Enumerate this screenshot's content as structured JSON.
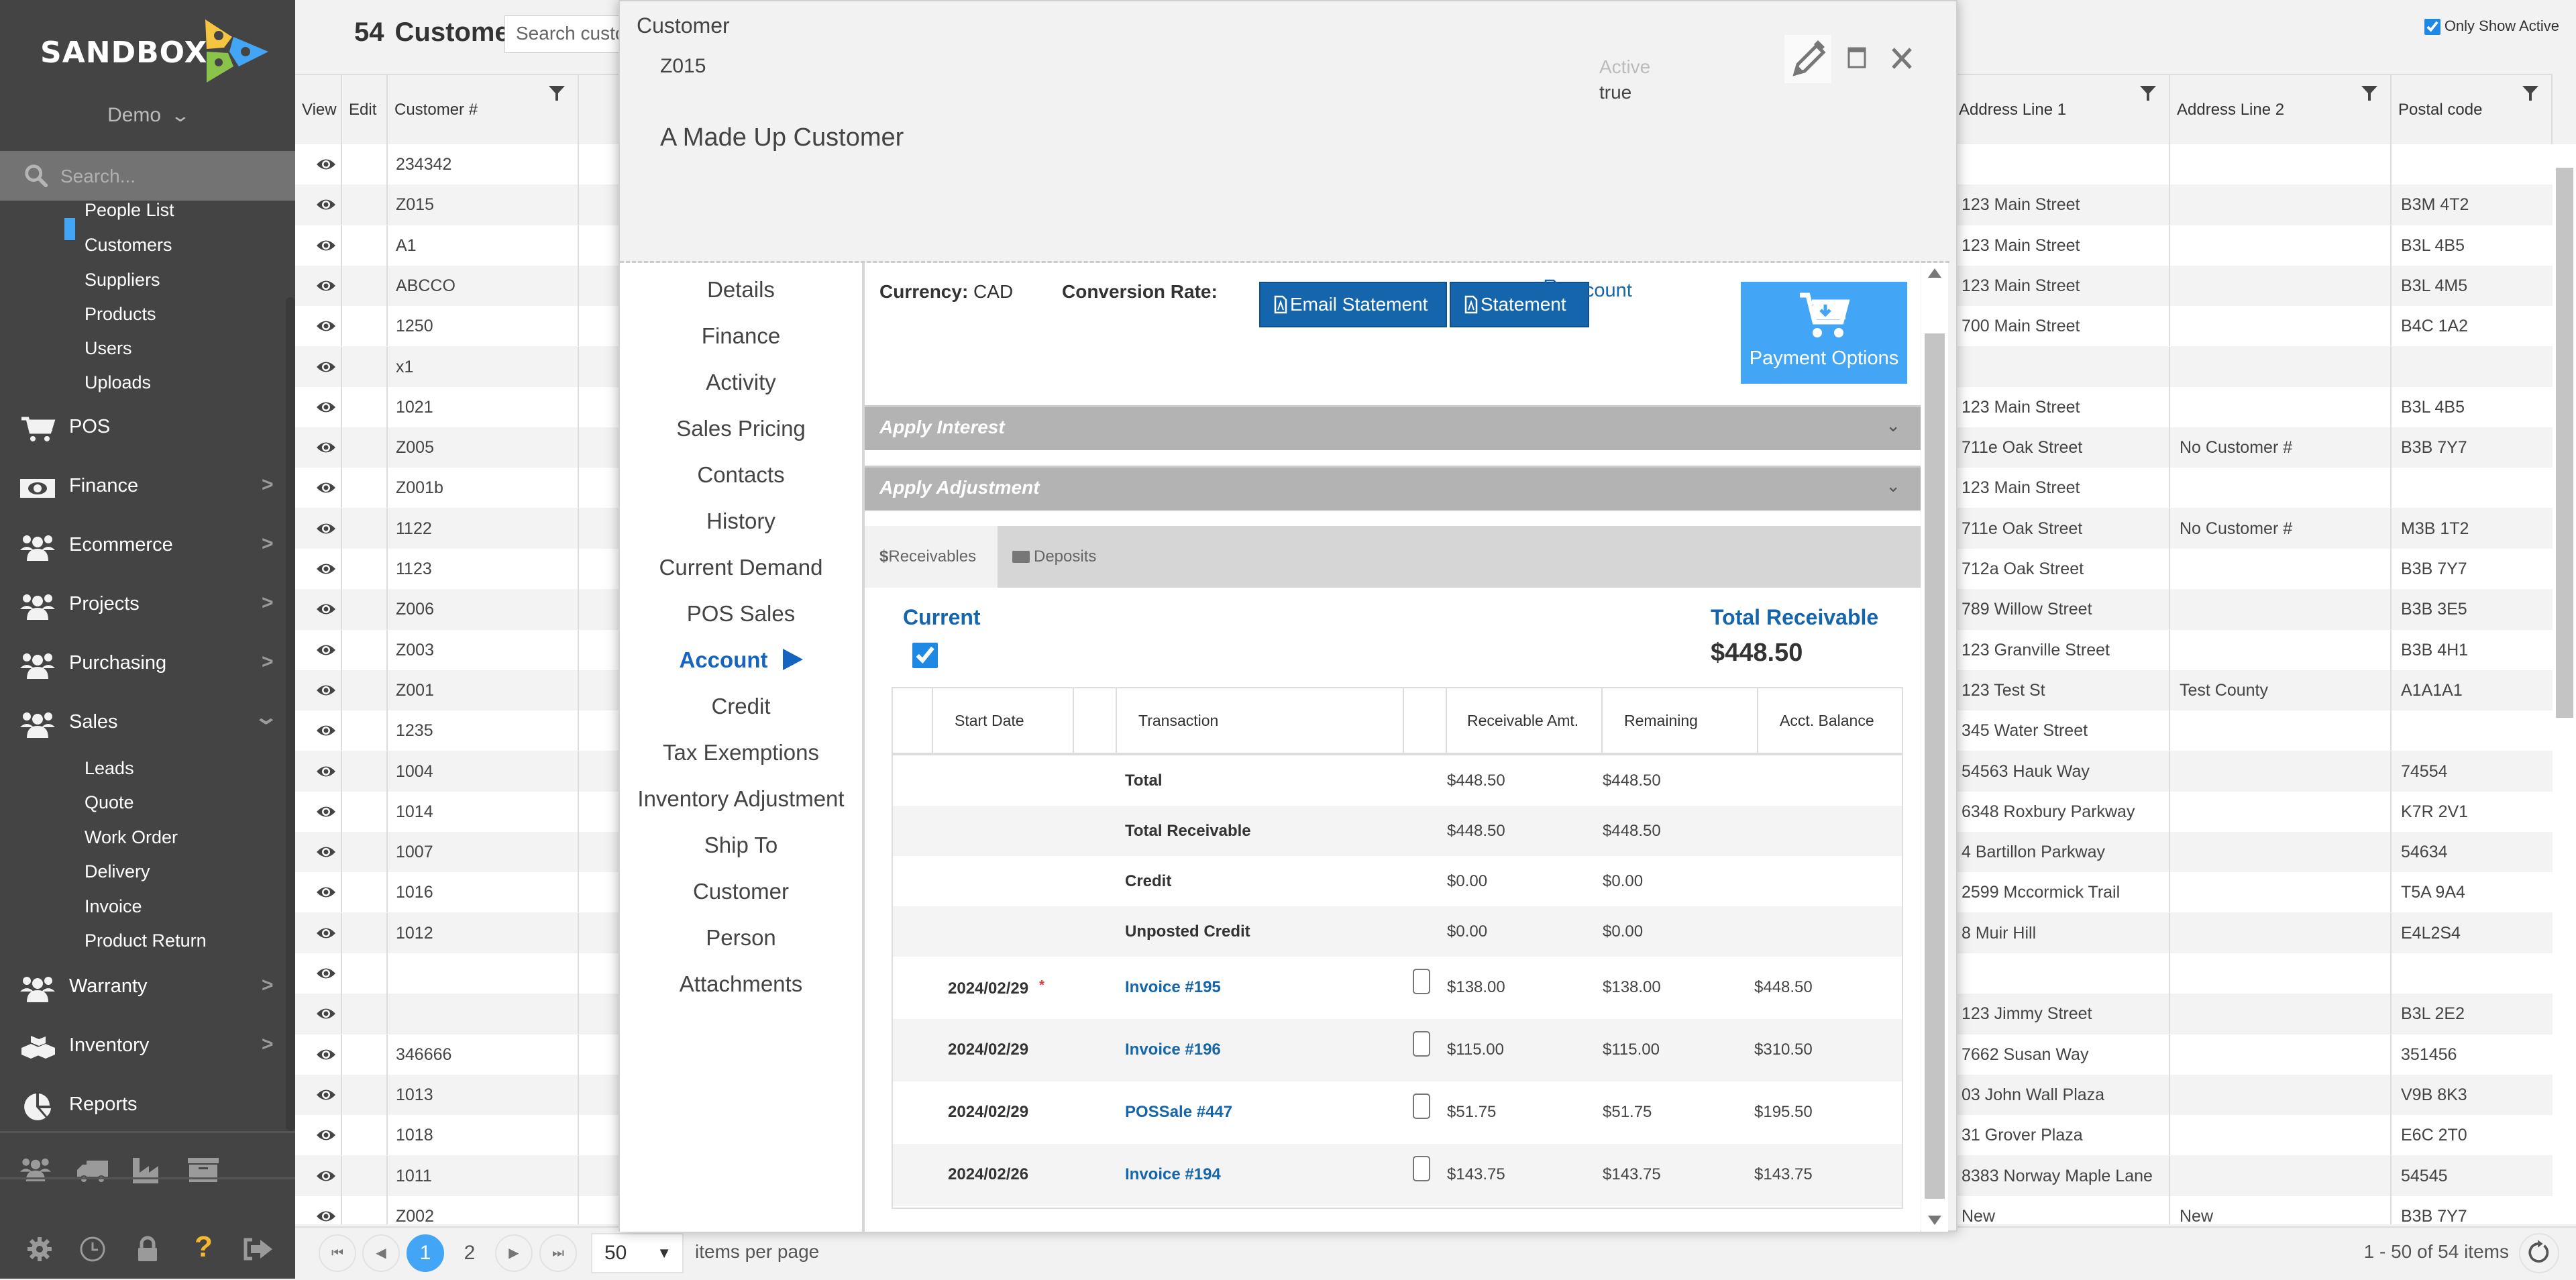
{
  "sidebar": {
    "brand": "SANDBOX",
    "company": "Demo",
    "search_placeholder": "Search...",
    "people_subitems": [
      "People List",
      "Customers",
      "Suppliers",
      "Products",
      "Users",
      "Uploads"
    ],
    "active_subitem": "Customers",
    "main_items": [
      {
        "label": "POS",
        "icon": "cart-icon",
        "arrow": ""
      },
      {
        "label": "Finance",
        "icon": "money-icon",
        "arrow": "right"
      },
      {
        "label": "Ecommerce",
        "icon": "users-icon",
        "arrow": "right"
      },
      {
        "label": "Projects",
        "icon": "users-icon",
        "arrow": "right"
      },
      {
        "label": "Purchasing",
        "icon": "users-icon",
        "arrow": "right"
      },
      {
        "label": "Sales",
        "icon": "users-icon",
        "arrow": "down"
      }
    ],
    "sales_subitems": [
      "Leads",
      "Quote",
      "Work Order",
      "Delivery",
      "Invoice",
      "Product Return"
    ],
    "lower_items": [
      {
        "label": "Warranty",
        "icon": "users-icon",
        "arrow": "right"
      },
      {
        "label": "Inventory",
        "icon": "boxes-icon",
        "arrow": "right"
      },
      {
        "label": "Reports",
        "icon": "pie-chart-icon",
        "arrow": ""
      }
    ],
    "quick_icons": [
      "users-icon",
      "truck-icon",
      "factory-icon",
      "archive-icon"
    ],
    "footer_icons": [
      "gear-icon",
      "clock-icon",
      "lock-icon",
      "help-icon",
      "sign-out-icon"
    ],
    "colors": {
      "bg": "#444444",
      "active_bar": "#42a5f5",
      "help": "#f5b82e"
    }
  },
  "list": {
    "count": "54",
    "title": "Customers",
    "search_placeholder": "Search custo",
    "only_show_active_label": "Only Show Active",
    "only_show_active": true,
    "columns": {
      "view": "View",
      "edit": "Edit",
      "customer_no": "Customer #",
      "address1": "Address Line 1",
      "address2": "Address Line 2",
      "postal": "Postal code"
    },
    "rows": [
      {
        "no": "234342",
        "addr1": "",
        "addr2": "",
        "postal": ""
      },
      {
        "no": "Z015",
        "addr1": "123 Main Street",
        "addr2": "",
        "postal": "B3M 4T2"
      },
      {
        "no": "A1",
        "addr1": "123 Main Street",
        "addr2": "",
        "postal": "B3L 4B5"
      },
      {
        "no": "ABCCO",
        "addr1": "123 Main Street",
        "addr2": "",
        "postal": "B3L 4M5"
      },
      {
        "no": "1250",
        "addr1": "700 Main Street",
        "addr2": "",
        "postal": "B4C 1A2"
      },
      {
        "no": "x1",
        "addr1": "",
        "addr2": "",
        "postal": ""
      },
      {
        "no": "1021",
        "addr1": "123 Main Street",
        "addr2": "",
        "postal": "B3L 4B5"
      },
      {
        "no": "Z005",
        "addr1": "711e Oak Street",
        "addr2": "No Customer #",
        "postal": "B3B 7Y7"
      },
      {
        "no": "Z001b",
        "addr1": "123 Main Street",
        "addr2": "",
        "postal": ""
      },
      {
        "no": "1122",
        "addr1": "711e Oak Street",
        "addr2": "No Customer #",
        "postal": "M3B 1T2"
      },
      {
        "no": "1123",
        "addr1": "712a Oak Street",
        "addr2": "",
        "postal": "B3B 7Y7"
      },
      {
        "no": "Z006",
        "addr1": "789 Willow Street",
        "addr2": "",
        "postal": "B3B 3E5"
      },
      {
        "no": "Z003",
        "addr1": "123 Granville Street",
        "addr2": "",
        "postal": "B3B 4H1"
      },
      {
        "no": "Z001",
        "addr1": "123 Test St",
        "addr2": "Test County",
        "postal": "A1A1A1"
      },
      {
        "no": "1235",
        "addr1": "345 Water Street",
        "addr2": "",
        "postal": ""
      },
      {
        "no": "1004",
        "addr1": "54563 Hauk Way",
        "addr2": "",
        "postal": "74554"
      },
      {
        "no": "1014",
        "addr1": "6348 Roxbury Parkway",
        "addr2": "",
        "postal": "K7R 2V1"
      },
      {
        "no": "1007",
        "addr1": "4 Bartillon Parkway",
        "addr2": "",
        "postal": "54634"
      },
      {
        "no": "1016",
        "addr1": "2599 Mccormick Trail",
        "addr2": "",
        "postal": "T5A 9A4"
      },
      {
        "no": "1012",
        "addr1": "8 Muir Hill",
        "addr2": "",
        "postal": "E4L2S4"
      },
      {
        "no": "",
        "addr1": "",
        "addr2": "",
        "postal": ""
      },
      {
        "no": "",
        "addr1": "123 Jimmy Street",
        "addr2": "",
        "postal": "B3L 2E2"
      },
      {
        "no": "346666",
        "addr1": "7662 Susan Way",
        "addr2": "",
        "postal": "351456"
      },
      {
        "no": "1013",
        "addr1": "03 John Wall Plaza",
        "addr2": "",
        "postal": "V9B 8K3"
      },
      {
        "no": "1018",
        "addr1": "31 Grover Plaza",
        "addr2": "",
        "postal": "E6C 2T0"
      },
      {
        "no": "1011",
        "addr1": "8383 Norway Maple Lane",
        "addr2": "",
        "postal": "54545"
      },
      {
        "no": "Z002",
        "addr1": "New",
        "addr2": "New",
        "postal": "B3B 7Y7"
      }
    ],
    "pager": {
      "pages": [
        "1",
        "2"
      ],
      "current_page": "1",
      "page_size": "50",
      "items_per_page_label": "items per page",
      "info": "1 - 50 of 54 items"
    }
  },
  "modal": {
    "title": "Customer",
    "code": "Z015",
    "name": "A Made Up Customer",
    "active_label": "Active",
    "active_value": "true",
    "nav": [
      "Details",
      "Finance",
      "Activity",
      "Sales Pricing",
      "Contacts",
      "History",
      "Current Demand",
      "POS Sales",
      "Account",
      "Credit",
      "Tax Exemptions",
      "Inventory Adjustment",
      "Ship To",
      "Customer",
      "Person",
      "Attachments"
    ],
    "active_nav": "Account",
    "currency_label": "Currency:",
    "currency_value": "CAD",
    "conversion_label": "Conversion Rate:",
    "conversion_value": "",
    "buttons": {
      "email_statement": "Email Statement",
      "statement": "Statement",
      "account": "Account",
      "payment_options": "Payment Options"
    },
    "accordions": [
      "Apply Interest",
      "Apply Adjustment"
    ],
    "tabs": [
      {
        "label": "Receivables",
        "icon": "dollar-icon",
        "active": true
      },
      {
        "label": "Deposits",
        "icon": "money-icon",
        "active": false
      }
    ],
    "current_label": "Current",
    "current_checked": true,
    "total_receivable_label": "Total Receivable",
    "total_receivable_value": "$448.50",
    "receivables": {
      "columns": [
        "Start Date",
        "Transaction",
        "Receivable Amt.",
        "Remaining",
        "Acct. Balance"
      ],
      "summary": [
        {
          "label": "Total",
          "amount": "$448.50",
          "remaining": "$448.50"
        },
        {
          "label": "Total Receivable",
          "amount": "$448.50",
          "remaining": "$448.50"
        },
        {
          "label": "Credit",
          "amount": "$0.00",
          "remaining": "$0.00"
        },
        {
          "label": "Unposted Credit",
          "amount": "$0.00",
          "remaining": "$0.00"
        }
      ],
      "rows": [
        {
          "date": "2024/02/29",
          "flag": "*",
          "transaction": "Invoice #195",
          "checked": false,
          "amount": "$138.00",
          "remaining": "$138.00",
          "balance": "$448.50"
        },
        {
          "date": "2024/02/29",
          "flag": "",
          "transaction": "Invoice #196",
          "checked": false,
          "amount": "$115.00",
          "remaining": "$115.00",
          "balance": "$310.50"
        },
        {
          "date": "2024/02/29",
          "flag": "",
          "transaction": "POSSale #447",
          "checked": false,
          "amount": "$51.75",
          "remaining": "$51.75",
          "balance": "$195.50"
        },
        {
          "date": "2024/02/26",
          "flag": "",
          "transaction": "Invoice #194",
          "checked": false,
          "amount": "$143.75",
          "remaining": "$143.75",
          "balance": "$143.75"
        }
      ]
    },
    "colors": {
      "primary": "#1565ad",
      "payment": "#42a5f5",
      "accordion": "#b3b3b3",
      "flag": "#e53935"
    }
  }
}
